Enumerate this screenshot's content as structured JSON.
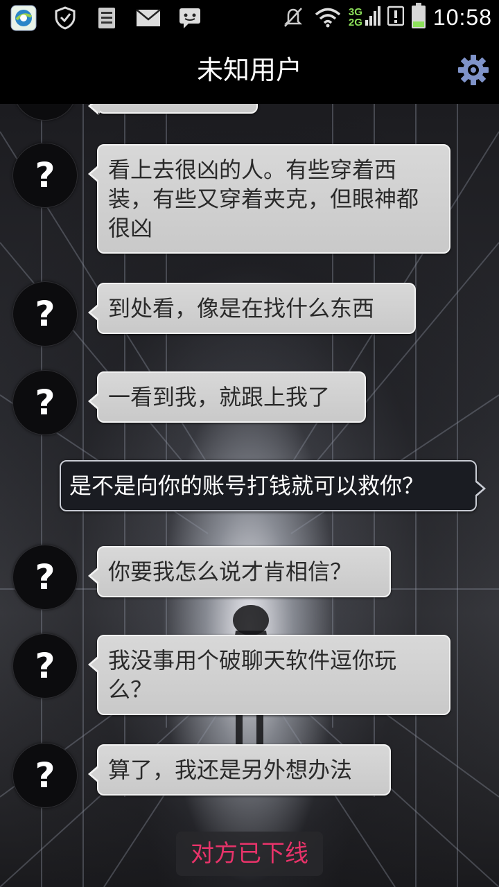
{
  "status_bar": {
    "time": "10:58",
    "network_top": "3G",
    "network_bottom": "2G",
    "icons": [
      "browser-app-icon",
      "shield-icon",
      "sd-card-icon",
      "mail-icon",
      "message-icon",
      "mute-icon",
      "wifi-icon",
      "signal-icon",
      "alert-icon",
      "battery-icon"
    ],
    "battery_level": 0.25
  },
  "header": {
    "title": "未知用户"
  },
  "chat": {
    "messages": [
      {
        "from": "other",
        "avatar": "?",
        "text": "看上去很凶的人。有些穿着西装，有些又穿着夹克，但眼神都很凶"
      },
      {
        "from": "other",
        "avatar": "?",
        "text": "到处看，像是在找什么东西"
      },
      {
        "from": "other",
        "avatar": "?",
        "text": "一看到我，就跟上我了"
      },
      {
        "from": "self",
        "text": "是不是向你的账号打钱就可以救你？"
      },
      {
        "from": "other",
        "avatar": "?",
        "text": "你要我怎么说才肯相信？"
      },
      {
        "from": "other",
        "avatar": "?",
        "text": "我没事用个破聊天软件逗你玩么？"
      },
      {
        "from": "other",
        "avatar": "?",
        "text": "算了，我还是另外想办法"
      }
    ],
    "status_notice": "对方已下线"
  },
  "colors": {
    "offline_text": "#e8336a",
    "settings_icon": "#7f93c9",
    "battery_fill": "#8de05b"
  }
}
